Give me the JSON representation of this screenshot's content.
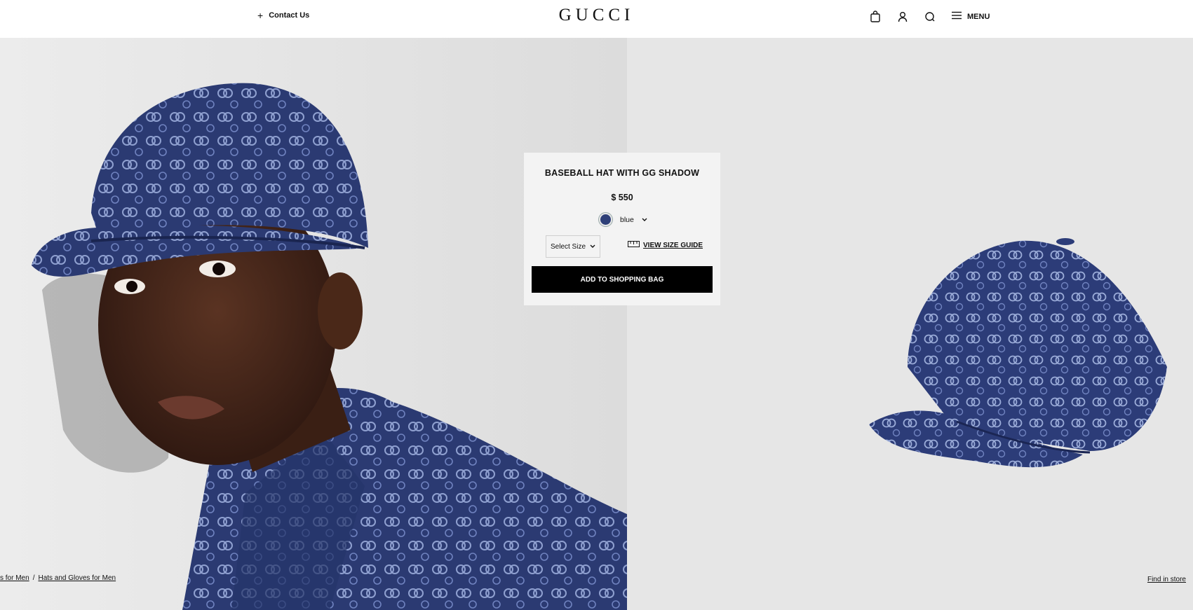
{
  "header": {
    "contact_label": "Contact Us",
    "logo_text": "GUCCI",
    "menu_label": "MENU",
    "icons": [
      "shopping-bag-icon",
      "account-icon",
      "search-icon",
      "menu-icon"
    ]
  },
  "product": {
    "title": "BASEBALL HAT WITH GG SHADOW",
    "price": "$ 550",
    "color_label": "blue",
    "color_hex": "#2e3f78",
    "size_select_label": "Select Size",
    "size_guide_label": "VIEW SIZE GUIDE",
    "add_to_bag_label": "ADD TO SHOPPING BAG"
  },
  "breadcrumb": {
    "items": [
      "s for Men",
      "Hats and Gloves for Men"
    ],
    "separator": "/"
  },
  "footer": {
    "find_in_store_label": "Find in store"
  },
  "colors": {
    "denim_blue": "#2b3a72",
    "background_grey": "#e4e4e4"
  }
}
